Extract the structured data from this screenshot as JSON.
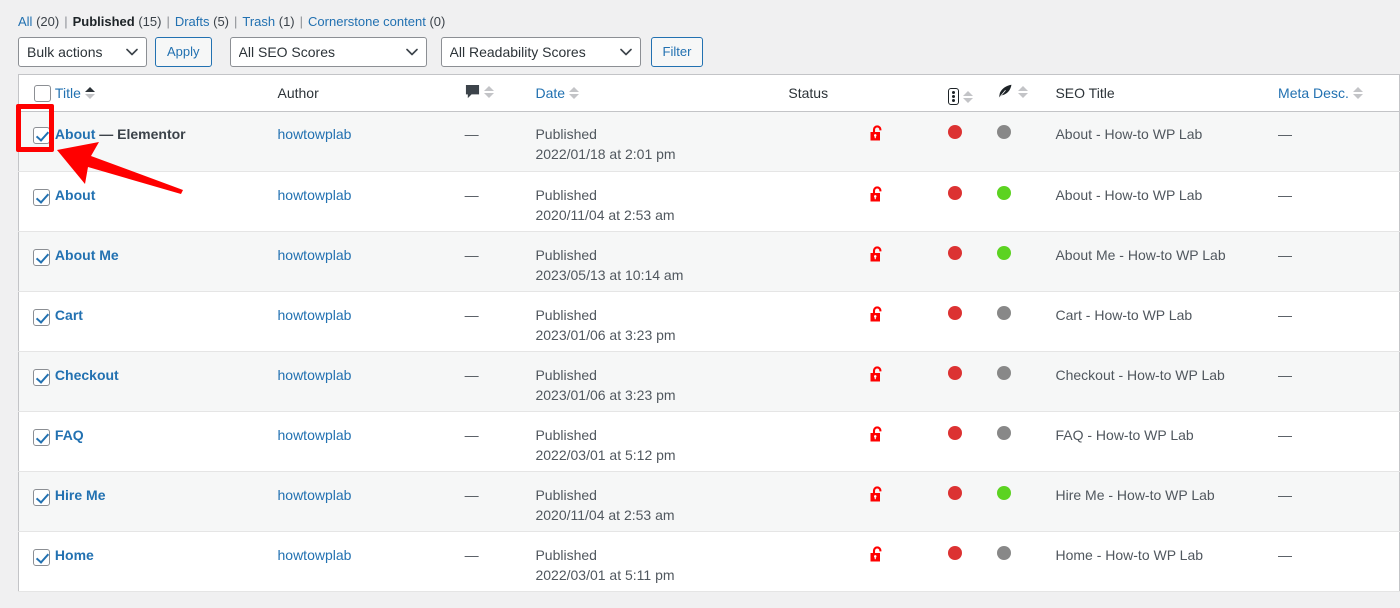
{
  "filters": {
    "items": [
      {
        "label": "All",
        "count": "(20)",
        "current": false
      },
      {
        "label": "Published",
        "count": "(15)",
        "current": true
      },
      {
        "label": "Drafts",
        "count": "(5)",
        "current": false
      },
      {
        "label": "Trash",
        "count": "(1)",
        "current": false
      },
      {
        "label": "Cornerstone content",
        "count": "(0)",
        "current": false
      }
    ],
    "separator": "|"
  },
  "toolbar": {
    "bulk_actions_value": "Bulk actions",
    "apply_label": "Apply",
    "seo_scores_value": "All SEO Scores",
    "readability_scores_value": "All Readability Scores",
    "filter_label": "Filter"
  },
  "table": {
    "headers": {
      "title": "Title",
      "author": "Author",
      "comments_icon": "comment-bubble-icon",
      "date": "Date",
      "status": "Status",
      "seo_score_icon": "traffic-light-icon",
      "readability_icon": "feather-pen-icon",
      "seo_title": "SEO Title",
      "meta_desc": "Meta Desc."
    },
    "em_dash": "—",
    "rows": [
      {
        "checked": true,
        "title": "About",
        "post_state": "— Elementor",
        "author": "howtowplab",
        "comments": "—",
        "status_word": "Published",
        "date": "2022/01/18 at 2:01 pm",
        "lock_icon": "unlocked-padlock-icon",
        "seo_dot": "#dc3232",
        "readability_dot": "#888888",
        "seo_title": "About - How-to WP Lab",
        "meta_desc": "—"
      },
      {
        "checked": true,
        "title": "About",
        "post_state": "",
        "author": "howtowplab",
        "comments": "—",
        "status_word": "Published",
        "date": "2020/11/04 at 2:53 am",
        "lock_icon": "unlocked-padlock-icon",
        "seo_dot": "#dc3232",
        "readability_dot": "#5cd321",
        "seo_title": "About - How-to WP Lab",
        "meta_desc": "—"
      },
      {
        "checked": true,
        "title": "About Me",
        "post_state": "",
        "author": "howtowplab",
        "comments": "—",
        "status_word": "Published",
        "date": "2023/05/13 at 10:14 am",
        "lock_icon": "unlocked-padlock-icon",
        "seo_dot": "#dc3232",
        "readability_dot": "#5cd321",
        "seo_title": "About Me - How-to WP Lab",
        "meta_desc": "—"
      },
      {
        "checked": true,
        "title": "Cart",
        "post_state": "",
        "author": "howtowplab",
        "comments": "—",
        "status_word": "Published",
        "date": "2023/01/06 at 3:23 pm",
        "lock_icon": "unlocked-padlock-icon",
        "seo_dot": "#dc3232",
        "readability_dot": "#888888",
        "seo_title": "Cart - How-to WP Lab",
        "meta_desc": "—"
      },
      {
        "checked": true,
        "title": "Checkout",
        "post_state": "",
        "author": "howtowplab",
        "comments": "—",
        "status_word": "Published",
        "date": "2023/01/06 at 3:23 pm",
        "lock_icon": "unlocked-padlock-icon",
        "seo_dot": "#dc3232",
        "readability_dot": "#888888",
        "seo_title": "Checkout - How-to WP Lab",
        "meta_desc": "—"
      },
      {
        "checked": true,
        "title": "FAQ",
        "post_state": "",
        "author": "howtowplab",
        "comments": "—",
        "status_word": "Published",
        "date": "2022/03/01 at 5:12 pm",
        "lock_icon": "unlocked-padlock-icon",
        "seo_dot": "#dc3232",
        "readability_dot": "#888888",
        "seo_title": "FAQ - How-to WP Lab",
        "meta_desc": "—"
      },
      {
        "checked": true,
        "title": "Hire Me",
        "post_state": "",
        "author": "howtowplab",
        "comments": "—",
        "status_word": "Published",
        "date": "2020/11/04 at 2:53 am",
        "lock_icon": "unlocked-padlock-icon",
        "seo_dot": "#dc3232",
        "readability_dot": "#5cd321",
        "seo_title": "Hire Me - How-to WP Lab",
        "meta_desc": "—"
      },
      {
        "checked": true,
        "title": "Home",
        "post_state": "",
        "author": "howtowplab",
        "comments": "—",
        "status_word": "Published",
        "date": "2022/03/01 at 5:11 pm",
        "lock_icon": "unlocked-padlock-icon",
        "seo_dot": "#dc3232",
        "readability_dot": "#888888",
        "seo_title": "Home - How-to WP Lab",
        "meta_desc": "—"
      }
    ]
  },
  "annotations": {
    "highlight_color": "#ff0000",
    "highlight_target": "first-row-checkbox",
    "arrow_color": "#ff0000"
  }
}
